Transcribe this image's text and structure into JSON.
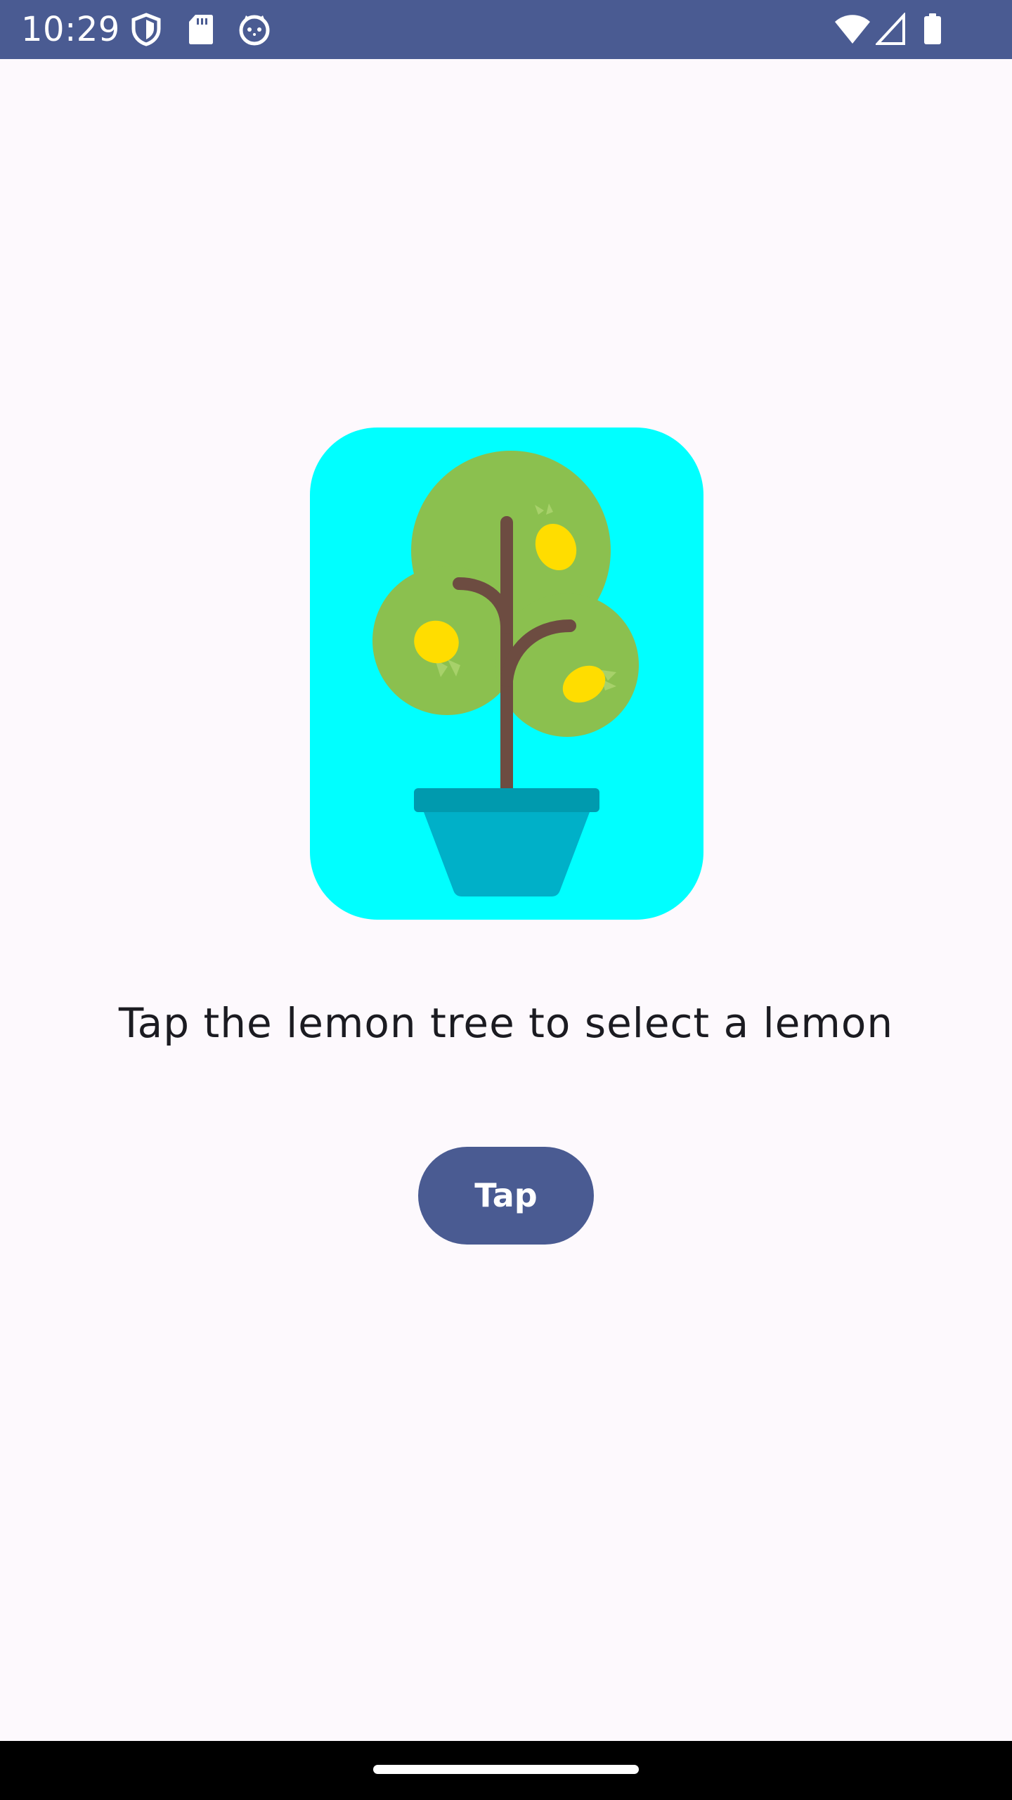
{
  "status_bar": {
    "time": "10:29",
    "background": "#4a5b92",
    "left_icons": [
      "shield-icon",
      "sd-card-icon",
      "cat-face-icon"
    ],
    "right_icons": [
      "wifi-icon",
      "cell-signal-icon",
      "battery-icon"
    ]
  },
  "main": {
    "image_alt": "lemon-tree-icon",
    "image_background": "#00ffff",
    "prompt": "Tap the lemon tree to select a lemon",
    "button_label": "Tap",
    "button_color": "#4a5b92"
  },
  "colors": {
    "page_background": "#fdf9fd",
    "text": "#1b1b21",
    "foliage": "#8bc04f",
    "trunk": "#6d4c41",
    "lemon": "#ffdd00",
    "pot": "#00b0c8",
    "pot_rim": "#009aae"
  }
}
